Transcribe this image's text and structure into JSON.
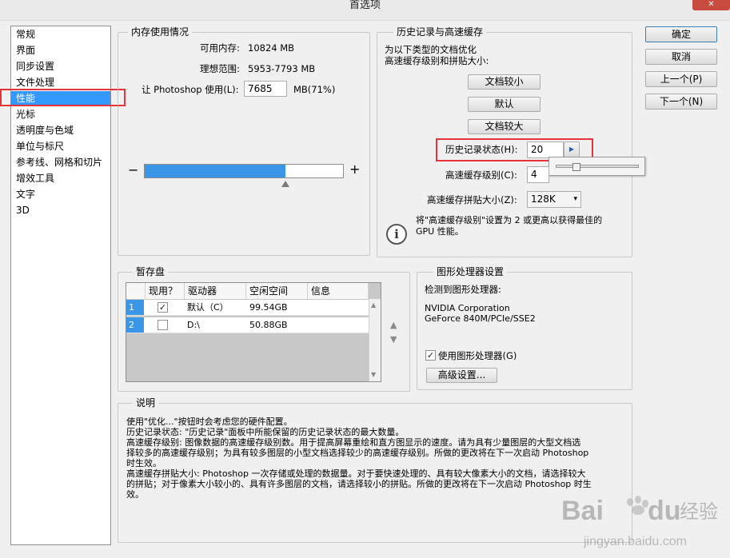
{
  "window": {
    "title": "首选项",
    "close_glyph": "✕"
  },
  "nav": {
    "items": [
      {
        "label": "常规"
      },
      {
        "label": "界面"
      },
      {
        "label": "同步设置"
      },
      {
        "label": "文件处理"
      },
      {
        "label": "性能"
      },
      {
        "label": "光标"
      },
      {
        "label": "透明度与色域"
      },
      {
        "label": "单位与标尺"
      },
      {
        "label": "参考线、网格和切片"
      },
      {
        "label": "增效工具"
      },
      {
        "label": "文字"
      },
      {
        "label": "3D"
      }
    ],
    "selected_index": 4
  },
  "memory": {
    "title": "内存使用情况",
    "available_label": "可用内存:",
    "available_value": "10824 MB",
    "ideal_label": "理想范围:",
    "ideal_value": "5953-7793 MB",
    "let_label": "让 Photoshop 使用(L):",
    "let_value": "7685",
    "unit_pct": "MB(71%)",
    "minus": "−",
    "plus": "+",
    "slider_fraction": 0.71
  },
  "history": {
    "title": "历史记录与高速缓存",
    "optimize_line1": "为以下类型的文档优化",
    "optimize_line2": "高速缓存级别和拼贴大小:",
    "btn_small": "文档较小",
    "btn_default": "默认",
    "btn_large": "文档较大",
    "states_label": "历史记录状态(H):",
    "states_value": "20",
    "cache_levels_label": "高速缓存级别(C):",
    "cache_levels_value": "4",
    "tile_size_label": "高速缓存拼贴大小(Z):",
    "tile_size_value": "128K",
    "info_line1": "将\"高速缓存级别\"设置为 2 或更高以获得最佳的",
    "info_line2": "GPU 性能。",
    "info_glyph": "i",
    "popup_slider_fraction": 0.2
  },
  "actions": {
    "ok": "确定",
    "cancel": "取消",
    "prev": "上一个(P)",
    "next": "下一个(N)"
  },
  "scratch": {
    "title": "暂存盘",
    "columns": [
      "现用？",
      "驱动器",
      "空闲空间",
      "信息"
    ],
    "rows": [
      {
        "num": "1",
        "checked": "✓",
        "drive": "默认（C）",
        "free": "99.54GB",
        "info": ""
      },
      {
        "num": "2",
        "checked": "",
        "drive": "D:\\",
        "free": "50.88GB",
        "info": ""
      }
    ]
  },
  "gpu": {
    "title": "图形处理器设置",
    "detected_label": "检测到图形处理器:",
    "vendor": "NVIDIA Corporation",
    "model": "GeForce 840M/PCIe/SSE2",
    "use_gpu_label": "使用图形处理器(G)",
    "use_gpu_checked": "✓",
    "advanced_button": "高级设置..."
  },
  "description": {
    "title": "说明",
    "text": "使用\"优化...\"按钮时会考虑您的硬件配置。\n历史记录状态: \"历史记录\"面板中所能保留的历史记录状态的最大数量。\n高速缓存级别: 图像数据的高速缓存级别数。用于提高屏幕重绘和直方图显示的速度。请为具有少量图层的大型文档选\n择较多的高速缓存级别；为具有较多图层的小型文档选择较少的高速缓存级别。所做的更改将在下一次启动 Photoshop\n时生效。\n高速缓存拼贴大小: Photoshop 一次存储或处理的数据量。对于要快速处理的、具有较大像素大小的文档，请选择较大\n的拼贴；对于像素大小较小的、具有许多图层的文档，请选择较小的拼贴。所做的更改将在下一次启动 Photoshop 时生\n效。"
  },
  "watermark": {
    "brand": "Bai",
    "brand2": "du",
    "cn": "经验",
    "url": "jingyan.baidu.com"
  },
  "colors": {
    "selection": "#3399ff",
    "highlight_red": "#e8323a",
    "slider_fill": "#3b96e8"
  }
}
